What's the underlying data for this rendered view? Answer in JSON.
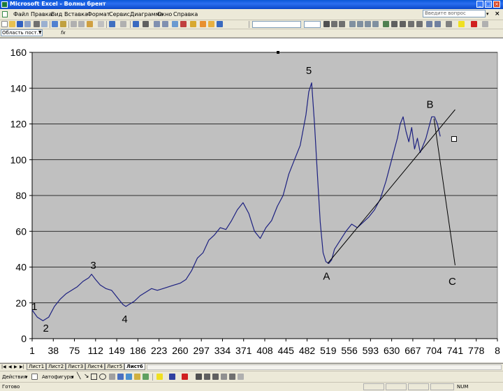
{
  "window": {
    "title": "Microsoft Excel - Волны брент"
  },
  "menu": {
    "items": [
      "Файл",
      "Правка",
      "Вид",
      "Вставка",
      "Формат",
      "Сервис",
      "Диаграмма",
      "Окно",
      "Справка"
    ],
    "ask_placeholder": "Введите вопрос"
  },
  "formula_bar": {
    "name_box": "Область пост…",
    "fx": "fx"
  },
  "chart_data": {
    "type": "line",
    "ylim": [
      0,
      160
    ],
    "y_ticks": [
      0,
      20,
      40,
      60,
      80,
      100,
      120,
      140,
      160
    ],
    "x_tick_labels": [
      "1",
      "38",
      "75",
      "112",
      "149",
      "186",
      "223",
      "260",
      "297",
      "334",
      "371",
      "408",
      "445",
      "482",
      "519",
      "556",
      "593",
      "630",
      "667",
      "704",
      "741",
      "778",
      "8"
    ],
    "xlim": [
      1,
      815
    ],
    "grid": true,
    "plot_background": "#c0c0c0",
    "line_color": "#1c2080",
    "series": [
      {
        "x": [
          1,
          10,
          20,
          30,
          40,
          50,
          60,
          70,
          75,
          80,
          90,
          100,
          105,
          112,
          120,
          130,
          140,
          145,
          150,
          155,
          160,
          165,
          170,
          180,
          190,
          200,
          210,
          220,
          230,
          240,
          250,
          260,
          270,
          280,
          290,
          300,
          310,
          320,
          330,
          340,
          350,
          360,
          370,
          380,
          390,
          400,
          410,
          420,
          430,
          440,
          450,
          460,
          470,
          480,
          485,
          490,
          495,
          500,
          505,
          510,
          515,
          520,
          525,
          530,
          540,
          550,
          560,
          570,
          580,
          590,
          600,
          610,
          620,
          630,
          640,
          645,
          650,
          655,
          660,
          665,
          670,
          675,
          680,
          685,
          690,
          695,
          700,
          705,
          710,
          715
        ],
        "y": [
          16,
          12,
          10,
          12,
          18,
          22,
          25,
          27,
          28,
          29,
          32,
          34,
          36,
          33,
          30,
          28,
          27,
          25,
          23,
          21,
          19,
          18,
          19,
          21,
          24,
          26,
          28,
          27,
          28,
          29,
          30,
          31,
          33,
          38,
          45,
          48,
          55,
          58,
          62,
          61,
          66,
          72,
          76,
          70,
          60,
          56,
          62,
          66,
          74,
          80,
          92,
          100,
          108,
          125,
          138,
          143,
          120,
          92,
          65,
          48,
          43,
          42,
          44,
          50,
          55,
          60,
          64,
          62,
          65,
          68,
          72,
          78,
          88,
          100,
          112,
          120,
          124,
          116,
          110,
          118,
          106,
          112,
          104,
          108,
          112,
          118,
          124,
          124,
          120,
          113
        ]
      }
    ],
    "annotations": [
      {
        "label": "1",
        "x": 5,
        "y": 16
      },
      {
        "label": "2",
        "x": 25,
        "y": 4
      },
      {
        "label": "3",
        "x": 108,
        "y": 39
      },
      {
        "label": "4",
        "x": 163,
        "y": 9
      },
      {
        "label": "5",
        "x": 485,
        "y": 148
      },
      {
        "label": "A",
        "x": 516,
        "y": 33
      },
      {
        "label": "B",
        "x": 697,
        "y": 129
      },
      {
        "label": "C",
        "x": 736,
        "y": 30
      }
    ],
    "drawn_lines": [
      {
        "from": [
          518,
          42
        ],
        "to": [
          741,
          128
        ]
      },
      {
        "from": [
          704,
          123
        ],
        "to": [
          741,
          41
        ]
      }
    ]
  },
  "sheets": {
    "tabs": [
      "Лист1",
      "Лист2",
      "Лист3",
      "Лист4",
      "Лист5",
      "Лист6"
    ],
    "active": "Лист6"
  },
  "drawing_toolbar": {
    "actions_label": "Действия",
    "autoshapes_label": "Автофигуры"
  },
  "status": {
    "ready": "Готово",
    "num": "NUM"
  }
}
